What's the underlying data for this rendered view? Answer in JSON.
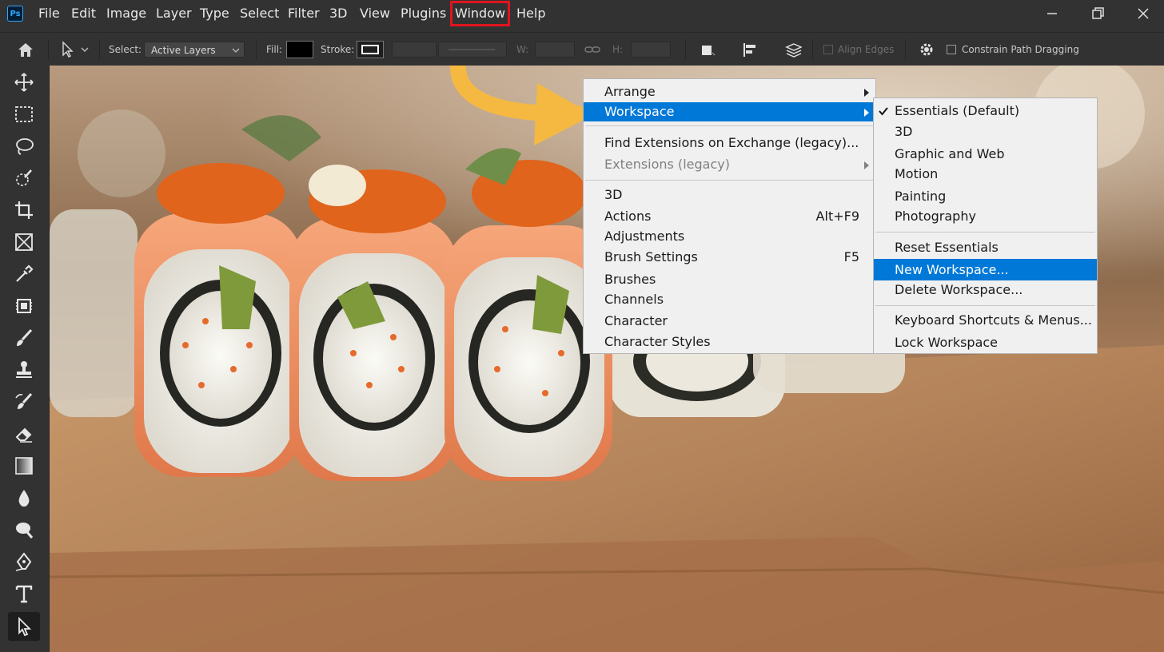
{
  "menubar": {
    "app_logo": "Ps",
    "items": [
      "File",
      "Edit",
      "Image",
      "Layer",
      "Type",
      "Select",
      "Filter",
      "3D",
      "View",
      "Plugins",
      "Window",
      "Help"
    ],
    "highlighted": "Window"
  },
  "window_controls": [
    "minimize-icon",
    "restore-icon",
    "close-icon"
  ],
  "options_bar": {
    "select_label": "Select:",
    "select_value": "Active Layers",
    "fill_label": "Fill:",
    "fill_color": "#000000",
    "stroke_label": "Stroke:",
    "w_label": "W:",
    "h_label": "H:",
    "align_edges_label": "Align Edges",
    "constrain_label": "Constrain Path Dragging"
  },
  "toolbar": {
    "tools": [
      "move-tool-icon",
      "marquee-tool-icon",
      "lasso-tool-icon",
      "quick-selection-tool-icon",
      "crop-tool-icon",
      "frame-tool-icon",
      "eyedropper-tool-icon",
      "healing-brush-tool-icon",
      "brush-tool-icon",
      "clone-stamp-tool-icon",
      "history-brush-tool-icon",
      "eraser-tool-icon",
      "gradient-tool-icon",
      "blur-tool-icon",
      "dodge-tool-icon",
      "pen-tool-icon",
      "type-tool-icon",
      "path-selection-tool-icon"
    ],
    "active": "path-selection-tool-icon"
  },
  "window_menu": {
    "groups": [
      [
        {
          "label": "Arrange",
          "submenu": true
        },
        {
          "label": "Workspace",
          "submenu": true,
          "highlighted": true
        }
      ],
      [
        {
          "label": "Find Extensions on Exchange (legacy)..."
        },
        {
          "label": "Extensions (legacy)",
          "submenu": true,
          "disabled": true
        }
      ],
      [
        {
          "label": "3D"
        },
        {
          "label": "Actions",
          "shortcut": "Alt+F9"
        },
        {
          "label": "Adjustments"
        },
        {
          "label": "Brush Settings",
          "shortcut": "F5"
        },
        {
          "label": "Brushes"
        },
        {
          "label": "Channels"
        },
        {
          "label": "Character"
        },
        {
          "label": "Character Styles"
        }
      ]
    ]
  },
  "workspace_submenu": {
    "groups": [
      [
        {
          "label": "Essentials (Default)",
          "checked": true
        },
        {
          "label": "3D"
        },
        {
          "label": "Graphic and Web"
        },
        {
          "label": "Motion"
        },
        {
          "label": "Painting"
        },
        {
          "label": "Photography"
        }
      ],
      [
        {
          "label": "Reset Essentials"
        },
        {
          "label": "New Workspace...",
          "highlighted": true
        },
        {
          "label": "Delete Workspace..."
        }
      ],
      [
        {
          "label": "Keyboard Shortcuts & Menus..."
        },
        {
          "label": "Lock Workspace"
        }
      ]
    ]
  },
  "annotation": {
    "arrow_color": "#f5b942"
  },
  "colors": {
    "highlight": "#0078d7",
    "callout": "#e0141e"
  }
}
